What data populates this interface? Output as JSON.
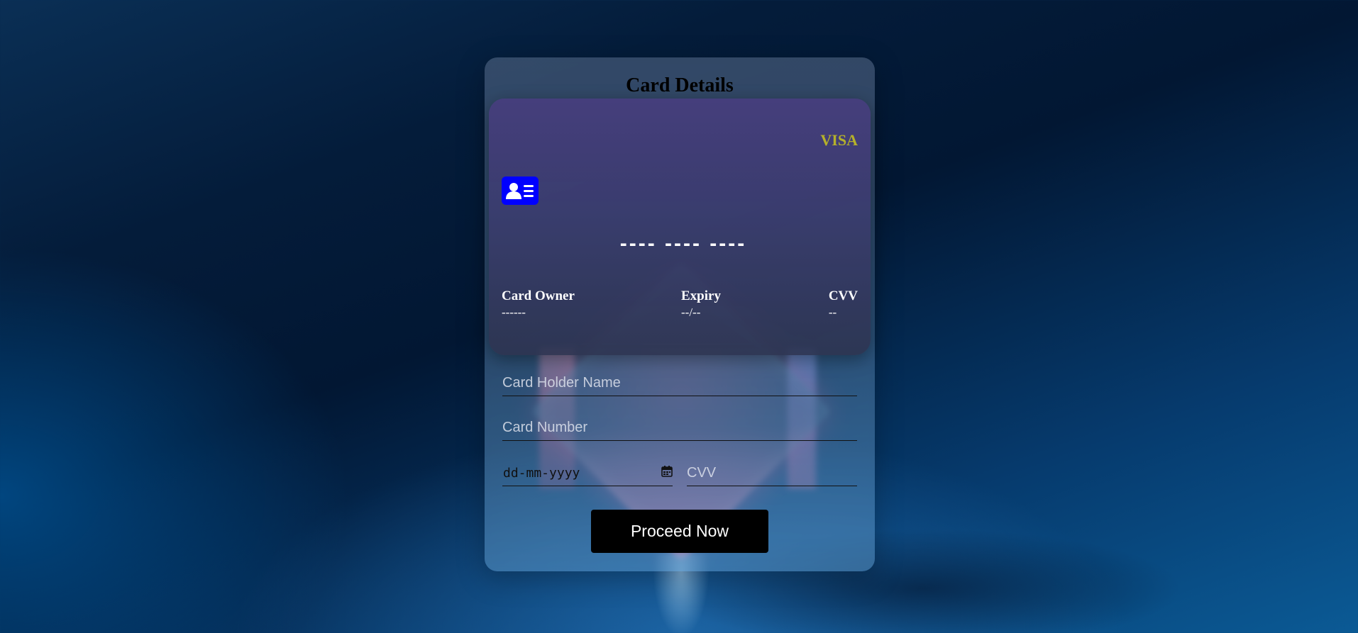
{
  "panel": {
    "title": "Card Details"
  },
  "card_preview": {
    "brand": "VISA",
    "brand_color": "#b5b12a",
    "chip_icon": "id-card-icon",
    "chip_color": "#0000ff",
    "number_mask": "---- ---- ----",
    "owner_label": "Card Owner",
    "owner_value": "------",
    "expiry_label": "Expiry",
    "expiry_value": "--/--",
    "cvv_label": "CVV",
    "cvv_value": "--"
  },
  "form": {
    "holder_name_placeholder": "Card Holder Name",
    "card_number_placeholder": "Card Number",
    "date_placeholder": "dd-mm-yyyy",
    "date_icon": "calendar-icon",
    "cvv_placeholder": "CVV",
    "submit_label": "Proceed Now"
  }
}
